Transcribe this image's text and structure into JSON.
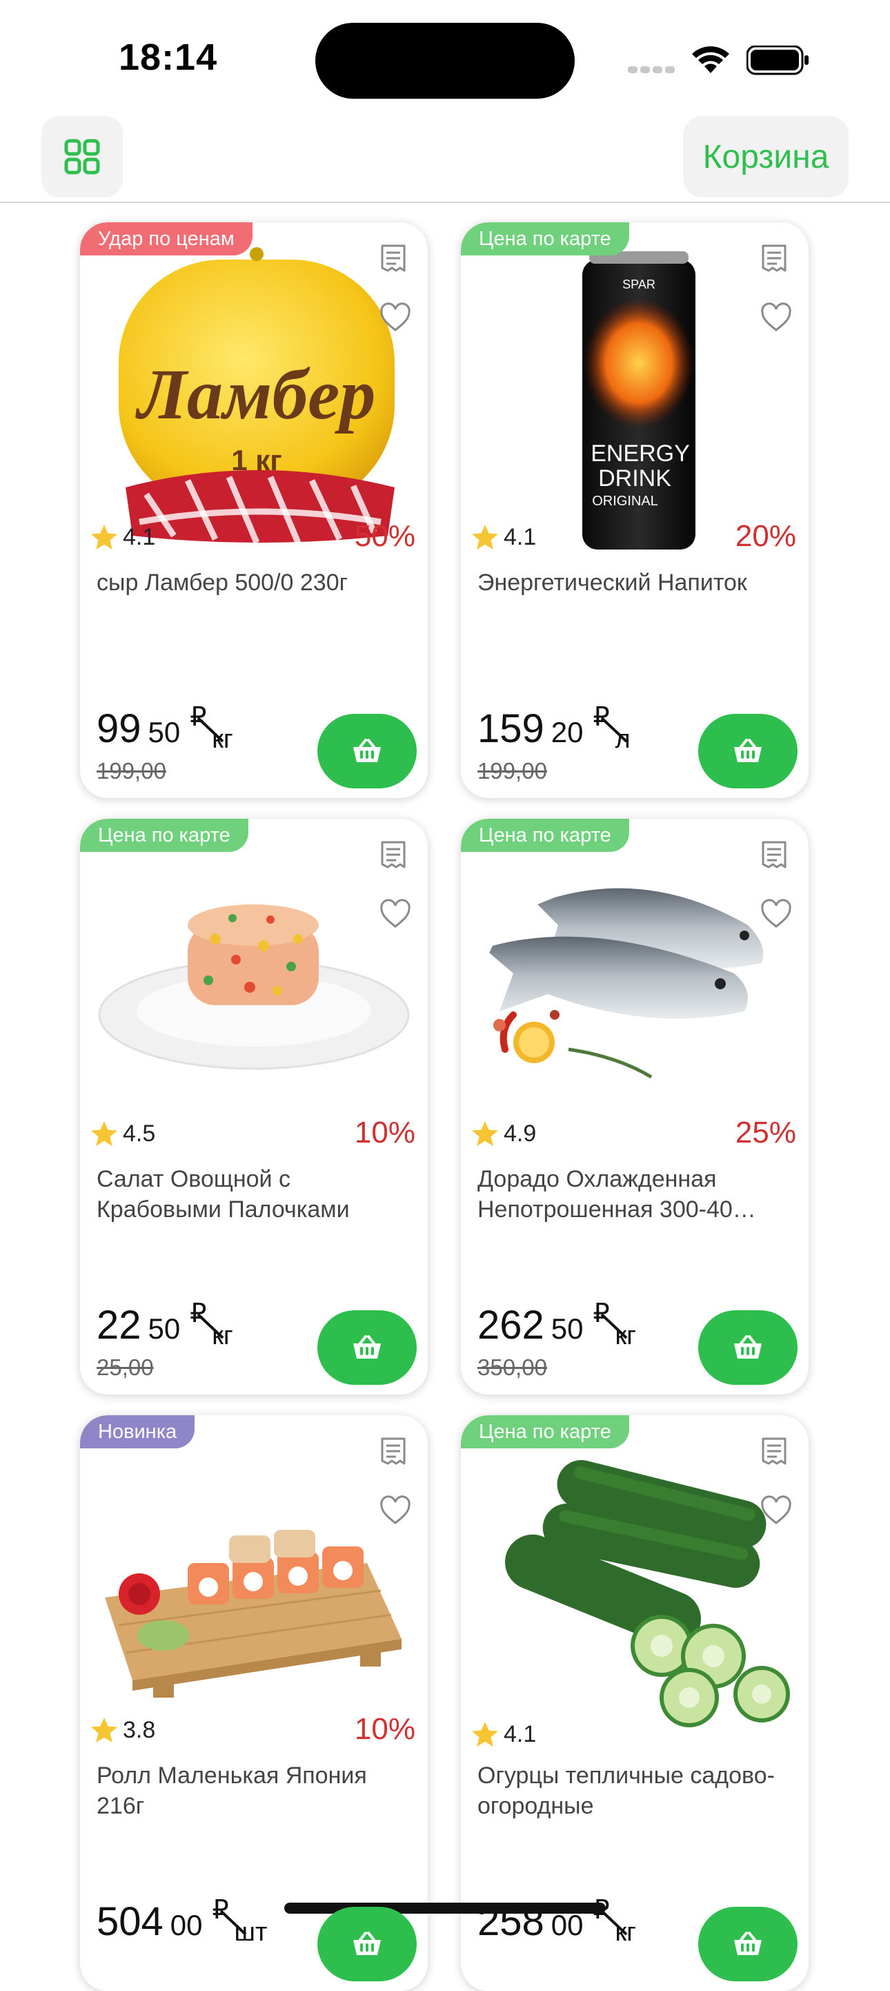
{
  "status_bar": {
    "time": "18:14"
  },
  "nav": {
    "cart_label": "Корзина"
  },
  "colors": {
    "accent_green": "#2fbf4f",
    "badge_sale": "#f26d73",
    "badge_card": "#6fd17c",
    "badge_new": "#8f86c9",
    "discount_red": "#d0302f",
    "star": "#f7c532"
  },
  "products": [
    {
      "badge": "Удар по ценам",
      "badge_kind": "sale",
      "rating": "4.1",
      "discount": "50%",
      "name": "сыр Ламбер 500/0 230г",
      "price_int": "99",
      "price_kop": "50",
      "currency": "₽",
      "unit": "кг",
      "old_price": "199,00",
      "image": "cheese",
      "image_text": "Ламбер",
      "image_text2": "1 кг"
    },
    {
      "badge": "Цена по карте",
      "badge_kind": "card",
      "rating": "4.1",
      "discount": "20%",
      "name": "Энергетический Напиток",
      "price_int": "159",
      "price_kop": "20",
      "currency": "₽",
      "unit": "л",
      "old_price": "199,00",
      "image": "energy-can",
      "image_text": "SPAR",
      "image_text2": "ENERGY",
      "image_text3": "DRINK",
      "image_text4": "ORIGINAL"
    },
    {
      "badge": "Цена по карте",
      "badge_kind": "card",
      "rating": "4.5",
      "discount": "10%",
      "name": "Салат Овощной с Крабовыми Палочками",
      "price_int": "22",
      "price_kop": "50",
      "currency": "₽",
      "unit": "кг",
      "old_price": "25,00",
      "image": "salad-plate"
    },
    {
      "badge": "Цена по карте",
      "badge_kind": "card",
      "rating": "4.9",
      "discount": "25%",
      "name": "Дорадо Охлажденная Непотрошенная 300-40…",
      "price_int": "262",
      "price_kop": "50",
      "currency": "₽",
      "unit": "кг",
      "old_price": "350,00",
      "image": "dorado-fish"
    },
    {
      "badge": "Новинка",
      "badge_kind": "new",
      "rating": "3.8",
      "discount": "10%",
      "name": "Ролл Маленькая Япония 216г",
      "price_int": "504",
      "price_kop": "00",
      "currency": "₽",
      "unit": "шт",
      "old_price": "",
      "image": "sushi-board"
    },
    {
      "badge": "Цена по карте",
      "badge_kind": "card",
      "rating": "4.1",
      "discount": "",
      "name": "Огурцы тепличные садово-огородные",
      "price_int": "258",
      "price_kop": "00",
      "currency": "₽",
      "unit": "кг",
      "old_price": "",
      "image": "cucumbers"
    }
  ]
}
